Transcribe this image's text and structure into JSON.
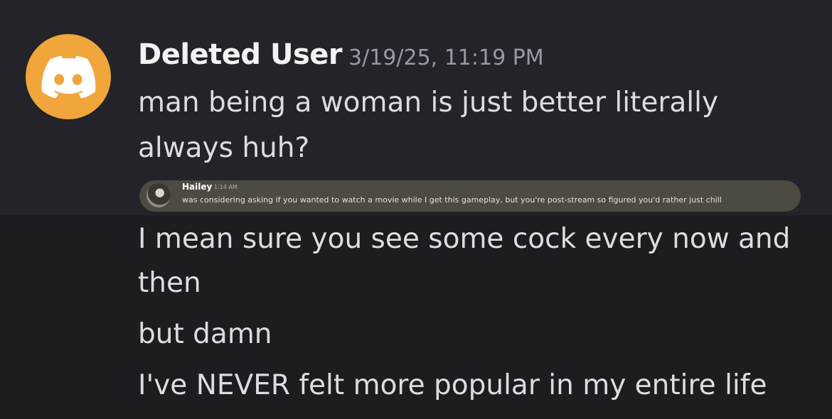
{
  "message": {
    "author": "Deleted User",
    "timestamp": "3/19/25, 11:19 PM",
    "avatar_icon": "discord-logo-icon",
    "avatar_color": "#f0a63b",
    "lines": [
      "man being a woman is just better literally",
      "always huh?"
    ],
    "followups": [
      "I mean sure you see some cock every now and",
      "then",
      "but damn",
      "I've NEVER felt more popular in my entire life"
    ]
  },
  "embed": {
    "author": "Hailey",
    "time": "1:14 AM",
    "text": "was considering asking if you wanted to watch a movie while I get this gameplay, but you're post-stream so figured you'd rather just chill"
  }
}
